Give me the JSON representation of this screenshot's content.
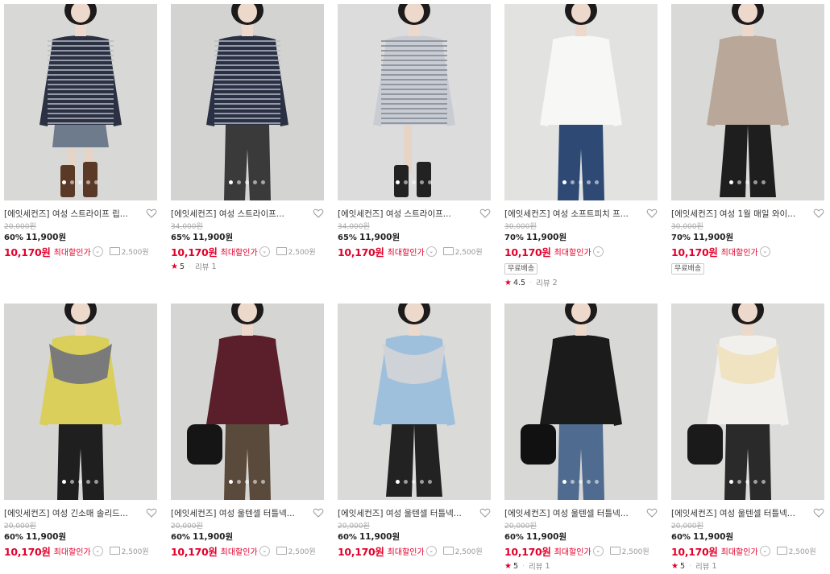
{
  "shipping_fee": "2,500원",
  "colors": {
    "sale_red": "#e4002b",
    "strike_gray": "#aaaaaa"
  },
  "products": [
    {
      "title": "[에잇세컨즈] 여성 스트라이프 립...",
      "original_price": "20,000원",
      "discount_rate": "60%",
      "discount_price": "11,900원",
      "max_price": "10,170원",
      "max_label": "최대할인가",
      "badge": "",
      "rating": "",
      "review_label": "",
      "review_count": "",
      "photo": {
        "bg": "#d8d8d6",
        "top": "#2b3142",
        "stripes": true,
        "bottom": "#6e7b8c",
        "bottom_type": "skirt",
        "shoes": "#5a3a26"
      }
    },
    {
      "title": "[에잇세컨즈] 여성 스트라이프...",
      "original_price": "34,000원",
      "discount_rate": "65%",
      "discount_price": "11,900원",
      "max_price": "10,170원",
      "max_label": "최대할인가",
      "badge": "",
      "rating": "5",
      "review_label": "리뷰",
      "review_count": "1",
      "photo": {
        "bg": "#d3d3d1",
        "top": "#2a3145",
        "stripes": true,
        "bottom": "#3a3a3a",
        "bottom_type": "pants",
        "shoes": "#222"
      }
    },
    {
      "title": "[에잇세컨즈] 여성 스트라이프...",
      "original_price": "34,000원",
      "discount_rate": "65%",
      "discount_price": "11,900원",
      "max_price": "10,170원",
      "max_label": "최대할인가",
      "badge": "",
      "rating": "",
      "review_label": "",
      "review_count": "",
      "photo": {
        "bg": "#dcdcdc",
        "top": "#c9cdd3",
        "stripes": true,
        "bottom": "#b9a68a",
        "bottom_type": "shorts",
        "shoes": "#222"
      }
    },
    {
      "title": "[에잇세컨즈] 여성 소프트피치 프...",
      "original_price": "30,000원",
      "discount_rate": "70%",
      "discount_price": "11,900원",
      "max_price": "10,170원",
      "max_label": "최대할인가",
      "badge": "무료배송",
      "rating": "4.5",
      "review_label": "리뷰",
      "review_count": "2",
      "photo": {
        "bg": "#e2e2e0",
        "top": "#f7f7f5",
        "stripes": false,
        "bottom": "#2e4a74",
        "bottom_type": "pants",
        "shoes": "#222"
      }
    },
    {
      "title": "[에잇세컨즈] 여성 1월 매일 와이...",
      "original_price": "30,000원",
      "discount_rate": "70%",
      "discount_price": "11,900원",
      "max_price": "10,170원",
      "max_label": "최대할인가",
      "badge": "무료배송",
      "rating": "",
      "review_label": "",
      "review_count": "",
      "photo": {
        "bg": "#d9d9d7",
        "top": "#b9a89a",
        "stripes": false,
        "bottom": "#1e1e1e",
        "bottom_type": "wide",
        "shoes": "#111"
      }
    },
    {
      "title": "[에잇세컨즈] 여성 긴소매 솔리드...",
      "original_price": "20,000원",
      "discount_rate": "60%",
      "discount_price": "11,900원",
      "max_price": "10,170원",
      "max_label": "최대할인가",
      "badge": "",
      "rating": "",
      "review_label": "",
      "review_count": "",
      "photo": {
        "bg": "#d6d6d4",
        "top": "#d9cf5a",
        "stripes": false,
        "bottom": "#1f1f1f",
        "bottom_type": "pants",
        "shoes": "#111",
        "scarf": "#7a7a7a"
      }
    },
    {
      "title": "[에잇세컨즈] 여성 울텐셀 터틀넥...",
      "original_price": "20,000원",
      "discount_rate": "60%",
      "discount_price": "11,900원",
      "max_price": "10,170원",
      "max_label": "최대할인가",
      "badge": "",
      "rating": "",
      "review_label": "",
      "review_count": "",
      "photo": {
        "bg": "#d5d5d3",
        "top": "#5a1f2a",
        "stripes": false,
        "bottom": "#5a4a3c",
        "bottom_type": "pants",
        "shoes": "#111",
        "bag": "#151515"
      }
    },
    {
      "title": "[에잇세컨즈] 여성 울텐셀 터틀넥...",
      "original_price": "20,000원",
      "discount_rate": "60%",
      "discount_price": "11,900원",
      "max_price": "10,170원",
      "max_label": "최대할인가",
      "badge": "",
      "rating": "",
      "review_label": "",
      "review_count": "",
      "photo": {
        "bg": "#dadad8",
        "top": "#9fc0dc",
        "stripes": false,
        "bottom": "#222222",
        "bottom_type": "wide",
        "shoes": "#111",
        "scarf": "#cfd2d6"
      }
    },
    {
      "title": "[에잇세컨즈] 여성 울텐셀 터틀넥...",
      "original_price": "20,000원",
      "discount_rate": "60%",
      "discount_price": "11,900원",
      "max_price": "10,170원",
      "max_label": "최대할인가",
      "badge": "",
      "rating": "5",
      "review_label": "리뷰",
      "review_count": "1",
      "photo": {
        "bg": "#d8d8d6",
        "top": "#1b1b1b",
        "stripes": false,
        "bottom": "#4f6b8f",
        "bottom_type": "pants",
        "shoes": "#111",
        "bag": "#111"
      }
    },
    {
      "title": "[에잇세컨즈] 여성 울텐셀 터틀넥...",
      "original_price": "20,000원",
      "discount_rate": "60%",
      "discount_price": "11,900원",
      "max_price": "10,170원",
      "max_label": "최대할인가",
      "badge": "",
      "rating": "5",
      "review_label": "리뷰",
      "review_count": "1",
      "photo": {
        "bg": "#dcdcda",
        "top": "#f1f0ec",
        "stripes": false,
        "bottom": "#2a2a2a",
        "bottom_type": "pants",
        "shoes": "#111",
        "scarf": "#efe3c2",
        "bag": "#1a1a1a"
      }
    }
  ]
}
